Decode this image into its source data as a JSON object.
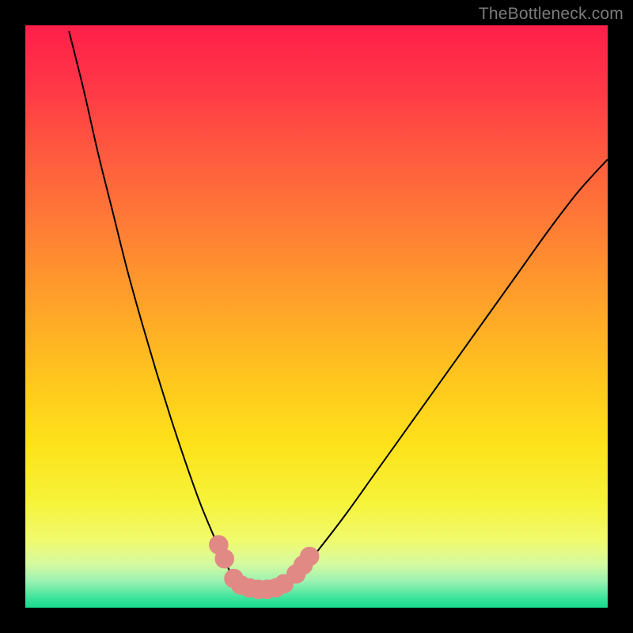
{
  "watermark": "TheBottleneck.com",
  "colors": {
    "frame": "#000000",
    "curve": "#000000",
    "marker_fill": "#e18a85",
    "marker_stroke": "#e18a85"
  },
  "chart_data": {
    "type": "line",
    "title": "",
    "xlabel": "",
    "ylabel": "",
    "xlim": [
      0,
      100
    ],
    "ylim": [
      0,
      100
    ],
    "grid": false,
    "annotations": [],
    "series": [
      {
        "name": "left-branch",
        "x": [
          7.5,
          10,
          12.5,
          15,
          17.5,
          20,
          22.5,
          25,
          27.5,
          30,
          32.5,
          35,
          36.5
        ],
        "values": [
          99,
          89,
          78,
          68,
          58,
          49,
          40.5,
          32.5,
          25,
          18,
          12,
          6.5,
          4
        ]
      },
      {
        "name": "valley-floor",
        "x": [
          36.5,
          38,
          40,
          42,
          43,
          44,
          45
        ],
        "values": [
          4,
          3.3,
          3.1,
          3.1,
          3.2,
          3.5,
          4
        ]
      },
      {
        "name": "right-branch",
        "x": [
          45,
          47.5,
          50,
          55,
          60,
          65,
          70,
          75,
          80,
          85,
          90,
          95,
          100
        ],
        "values": [
          4,
          6.5,
          9.5,
          16,
          23,
          30,
          37,
          44,
          51,
          58,
          65,
          71.5,
          77
        ]
      }
    ],
    "markers": {
      "name": "highlighted-points",
      "points": [
        {
          "x": 33.2,
          "y": 10.8
        },
        {
          "x": 34.2,
          "y": 8.4
        },
        {
          "x": 35.8,
          "y": 5.0
        },
        {
          "x": 37.0,
          "y": 3.9
        },
        {
          "x": 38.5,
          "y": 3.4
        },
        {
          "x": 40.0,
          "y": 3.15
        },
        {
          "x": 41.5,
          "y": 3.15
        },
        {
          "x": 43.0,
          "y": 3.4
        },
        {
          "x": 44.4,
          "y": 4.1
        },
        {
          "x": 46.5,
          "y": 5.8
        },
        {
          "x": 47.7,
          "y": 7.3
        },
        {
          "x": 48.8,
          "y": 8.8
        }
      ],
      "radius_data_units": 1.6
    }
  }
}
